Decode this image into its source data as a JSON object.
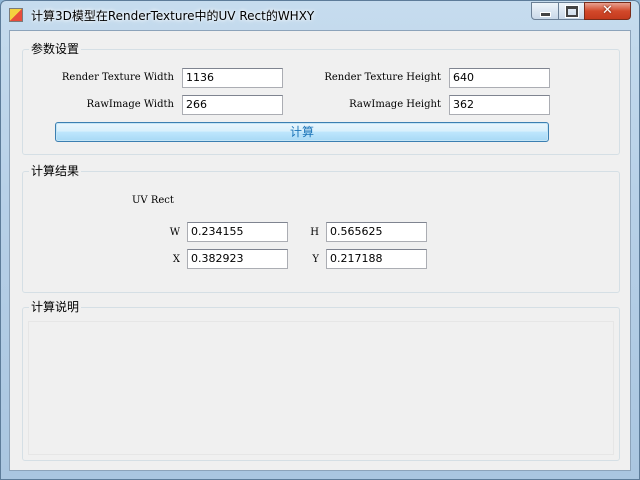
{
  "window": {
    "title": "计算3D模型在RenderTexture中的UV Rect的WHXY",
    "controls": {
      "minimize_icon": "minimize-icon",
      "maximize_icon": "maximize-icon",
      "close_icon": "close-icon",
      "close_glyph": "✕"
    }
  },
  "params": {
    "legend": "参数设置",
    "rt_width_label": "Render Texture Width",
    "rt_width_value": "1136",
    "rt_height_label": "Render Texture Height",
    "rt_height_value": "640",
    "raw_width_label": "RawImage Width",
    "raw_width_value": "266",
    "raw_height_label": "RawImage Height",
    "raw_height_value": "362",
    "calculate_label": "计算"
  },
  "results": {
    "legend": "计算结果",
    "uv_rect_label": "UV Rect",
    "w_label": "W",
    "w_value": "0.234155",
    "h_label": "H",
    "h_value": "0.565625",
    "x_label": "X",
    "x_value": "0.382923",
    "y_label": "Y",
    "y_value": "0.217188"
  },
  "notes": {
    "legend": "计算说明",
    "content": ""
  },
  "colors": {
    "button_text": "#1b74b8",
    "close_button": "#c43a1d",
    "form_background": "#f0f0f0"
  }
}
